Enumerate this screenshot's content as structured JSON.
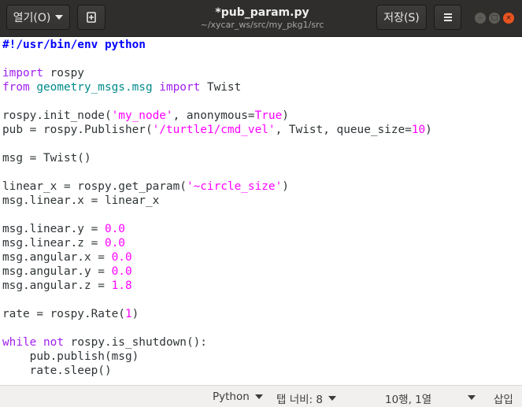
{
  "header": {
    "open_label": "열기(O)",
    "title": "*pub_param.py",
    "subtitle": "~/xycar_ws/src/my_pkg1/src",
    "save_label": "저장(S)"
  },
  "code_lines": [
    [
      {
        "t": "#!/usr/bin/env python",
        "c": "cm"
      }
    ],
    [],
    [
      {
        "t": "import",
        "c": "kw"
      },
      {
        "t": " rospy"
      }
    ],
    [
      {
        "t": "from",
        "c": "kw"
      },
      {
        "t": " "
      },
      {
        "t": "geometry_msgs.msg",
        "c": "md"
      },
      {
        "t": " "
      },
      {
        "t": "import",
        "c": "kw"
      },
      {
        "t": " Twist"
      }
    ],
    [],
    [
      {
        "t": "rospy.init_node("
      },
      {
        "t": "'my_node'",
        "c": "st"
      },
      {
        "t": ", anonymous="
      },
      {
        "t": "True",
        "c": "st"
      },
      {
        "t": ")"
      }
    ],
    [
      {
        "t": "pub = rospy.Publisher("
      },
      {
        "t": "'/turtle1/cmd_vel'",
        "c": "st"
      },
      {
        "t": ", Twist, queue_size="
      },
      {
        "t": "10",
        "c": "st"
      },
      {
        "t": ")"
      }
    ],
    [],
    [
      {
        "t": "msg = Twist()"
      }
    ],
    [],
    [
      {
        "t": "linear_x = rospy.get_param("
      },
      {
        "t": "'~circle_size'",
        "c": "st"
      },
      {
        "t": ")"
      }
    ],
    [
      {
        "t": "msg.linear.x = linear_x"
      }
    ],
    [],
    [
      {
        "t": "msg.linear.y = "
      },
      {
        "t": "0.0",
        "c": "st"
      }
    ],
    [
      {
        "t": "msg.linear.z = "
      },
      {
        "t": "0.0",
        "c": "st"
      }
    ],
    [
      {
        "t": "msg.angular.x = "
      },
      {
        "t": "0.0",
        "c": "st"
      }
    ],
    [
      {
        "t": "msg.angular.y = "
      },
      {
        "t": "0.0",
        "c": "st"
      }
    ],
    [
      {
        "t": "msg.angular.z = "
      },
      {
        "t": "1.8",
        "c": "st"
      }
    ],
    [],
    [
      {
        "t": "rate = rospy.Rate("
      },
      {
        "t": "1",
        "c": "st"
      },
      {
        "t": ")"
      }
    ],
    [],
    [
      {
        "t": "while",
        "c": "kw"
      },
      {
        "t": " "
      },
      {
        "t": "not",
        "c": "kw"
      },
      {
        "t": " rospy.is_shutdown():"
      }
    ],
    [
      {
        "t": "    pub.publish(msg)"
      }
    ],
    [
      {
        "t": "    rate.sleep()"
      }
    ]
  ],
  "statusbar": {
    "language": "Python",
    "tab_width": "탭 너비: 8",
    "position": "10행, 1열",
    "mode": "삽입"
  }
}
